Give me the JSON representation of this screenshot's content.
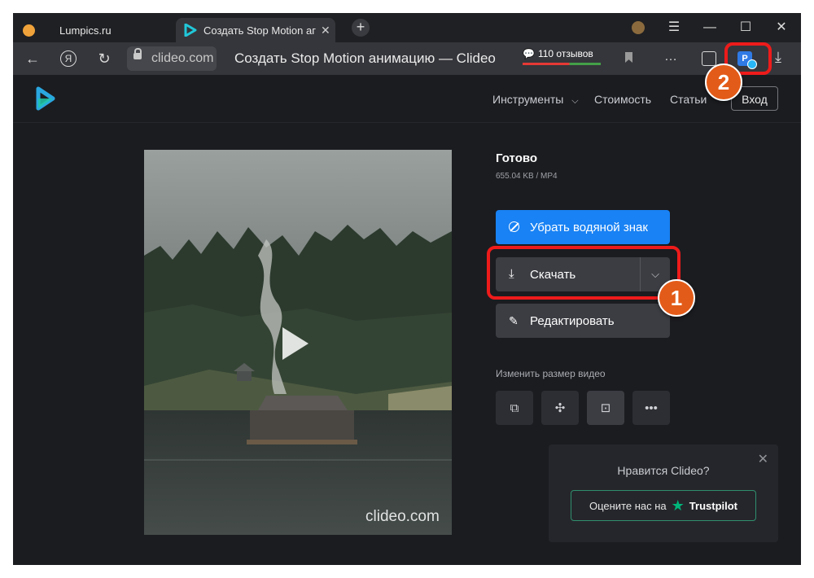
{
  "browser": {
    "tabs": [
      {
        "label": "Lumpics.ru"
      },
      {
        "label": "Создать Stop Motion анимацию — Clideo",
        "visible_label": "Создать Stop Motion аг"
      }
    ],
    "domain": "clideo.com",
    "page_title": "Создать Stop Motion анимацию — Clideo",
    "reviews": "110 отзывов"
  },
  "site": {
    "nav": [
      {
        "label": "Инструменты"
      },
      {
        "label": "Стоимость"
      },
      {
        "label": "Статьи"
      }
    ],
    "login": "Вход"
  },
  "result": {
    "status": "Готово",
    "meta": "655.04 KB  /  MP4",
    "watermark": "clideo.com",
    "remove_watermark": "Убрать водяной знак",
    "download": "Скачать",
    "edit": "Редактировать",
    "resize_label": "Изменить размер видео"
  },
  "promo": {
    "question": "Нравится Clideo?",
    "rate_prefix": "Оцените нас на",
    "brand": "Trustpilot"
  },
  "annotations": {
    "badge1": "1",
    "badge2": "2"
  },
  "colors": {
    "accent": "#1982f4",
    "highlight": "#ee1b1b",
    "badge": "#e35b18",
    "trustpilot": "#00b67a"
  }
}
